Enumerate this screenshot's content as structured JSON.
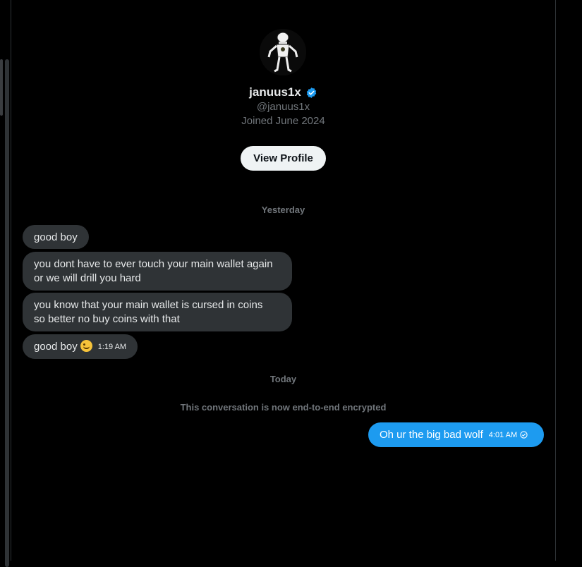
{
  "profile": {
    "display_name": "januus1x",
    "handle": "@januus1x",
    "joined": "Joined June 2024",
    "view_profile_label": "View Profile",
    "verified_icon": "verified-badge-icon"
  },
  "dates": {
    "yesterday": "Yesterday",
    "today": "Today"
  },
  "messages_incoming": [
    {
      "text": "good boy"
    },
    {
      "line1": "you dont have to ever touch your main wallet again",
      "line2": "or we will drill you hard"
    },
    {
      "line1": "you know that your main wallet is cursed in coins",
      "line2": "so better no buy coins with that"
    },
    {
      "text": "good boy",
      "emoji": "winking-tongue-face",
      "time": "1:19 AM"
    }
  ],
  "encrypted_note": "This conversation is now end-to-end encrypted",
  "message_outgoing": {
    "text": "Oh ur the big bad wolf",
    "time": "4:01 AM",
    "status_icon": "sent-check-icon"
  },
  "colors": {
    "background": "#000000",
    "bubble_incoming": "#2f3336",
    "bubble_outgoing": "#1d9bf0",
    "verified": "#1d9bf0",
    "secondary_text": "#71767b"
  }
}
